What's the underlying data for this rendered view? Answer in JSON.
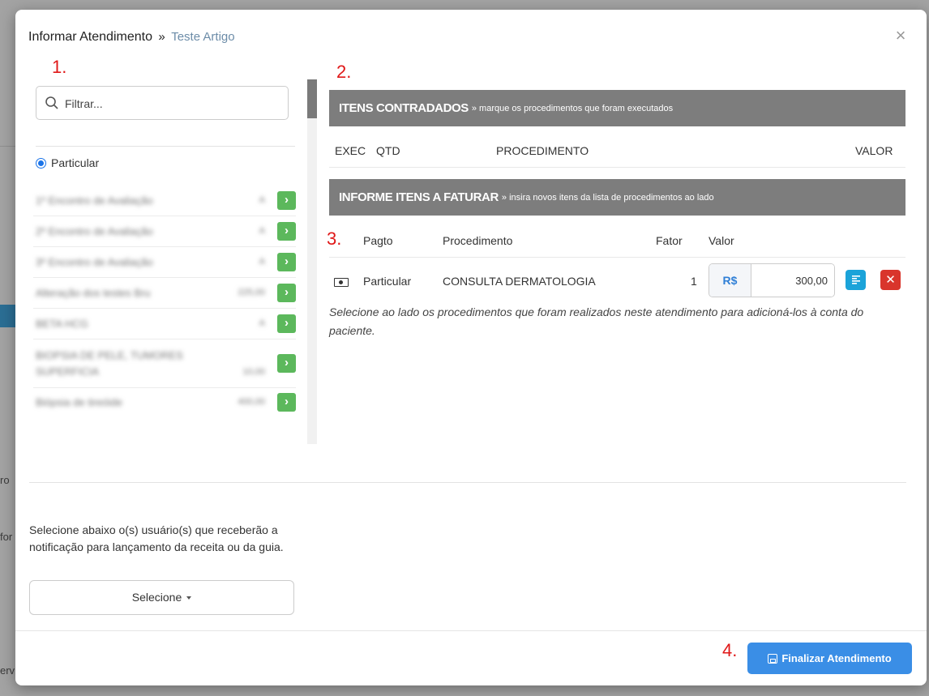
{
  "background": {
    "fragments": [
      "ro",
      "for",
      "erv"
    ]
  },
  "modal": {
    "title": "Informar Atendimento",
    "separator": "»",
    "subtitle": "Teste Artigo",
    "close_icon": "close-icon"
  },
  "markers": {
    "m1": "1.",
    "m2": "2.",
    "m3": "3.",
    "m4": "4."
  },
  "left_panel": {
    "filter_placeholder": "Filtrar...",
    "radio_label": "Particular",
    "procedures": [
      {
        "name": "1º Encontro de Avaliação",
        "price": "A",
        "add_label": "›"
      },
      {
        "name": "2º Encontro de Avaliação",
        "price": "A",
        "add_label": "›"
      },
      {
        "name": "3º Encontro de Avaliação",
        "price": "A",
        "add_label": "›"
      },
      {
        "name": "Alteração dos testes Bru",
        "price": "225,00",
        "add_label": "›"
      },
      {
        "name": "BETA HCG",
        "price": "A",
        "add_label": "›"
      },
      {
        "name": "BIOPSIA DE PELE, TUMORES SUPERFICIA",
        "price": "10,00",
        "add_label": "›"
      },
      {
        "name": "Biópsia de tireóide",
        "price": "400,00",
        "add_label": "›"
      }
    ],
    "notify_text": "Selecione abaixo o(s) usuário(s) que receberão a notificação para lançamento da receita ou da guia.",
    "select_label": "Selecione"
  },
  "right_panel": {
    "contracted_bar": {
      "title": "ITENS CONTRADADOS",
      "note": "» marque os procedimentos que foram executados"
    },
    "contracted_headers": {
      "exec": "EXEC",
      "qtd": "QTD",
      "procedimento": "PROCEDIMENTO",
      "valor": "VALOR"
    },
    "billing_bar": {
      "title": "INFORME ITENS A FATURAR",
      "note": "» insira novos itens da lista de procedimentos ao lado"
    },
    "billing_headers": {
      "pagto": "Pagto",
      "procedimento": "Procedimento",
      "fator": "Fator",
      "valor": "Valor"
    },
    "billing_row": {
      "payment": "Particular",
      "procedure": "CONSULTA DERMATOLOGIA",
      "factor": "1",
      "currency": "R$",
      "value": "300,00"
    },
    "hint": "Selecione ao lado os procedimentos que foram realizados neste atendimento para adicioná-los à conta do paciente."
  },
  "footer": {
    "finish_label": "Finalizar Atendimento"
  }
}
